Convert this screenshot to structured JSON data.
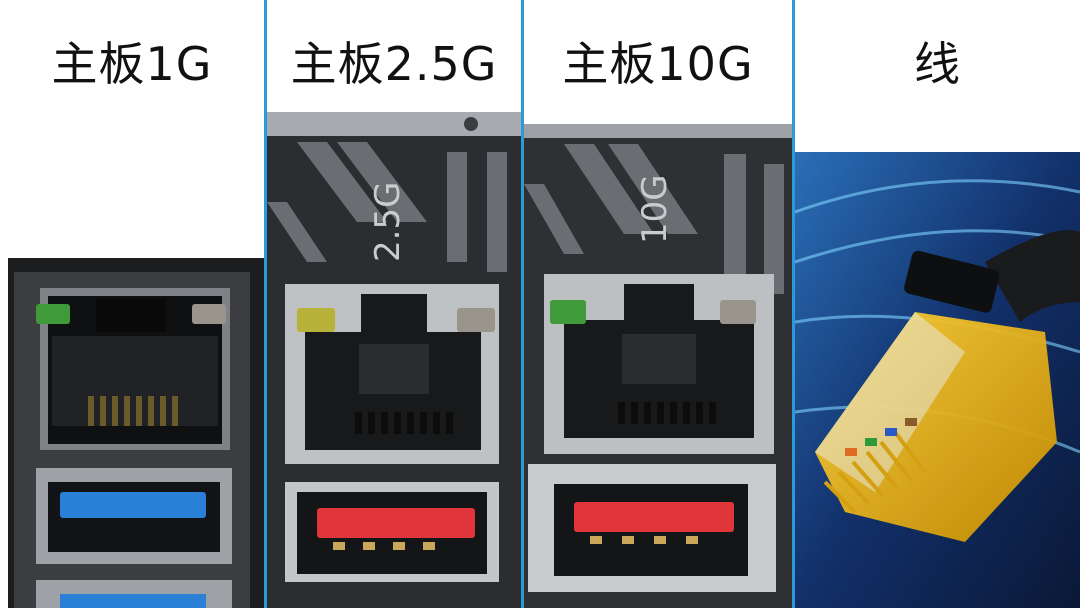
{
  "panels": [
    {
      "label": "主板1G",
      "port_speed_text": ""
    },
    {
      "label": "主板2.5G",
      "port_speed_text": "2.5G"
    },
    {
      "label": "主板10G",
      "port_speed_text": "10G"
    },
    {
      "label": "线",
      "port_speed_text": ""
    }
  ],
  "colors": {
    "divider": "#2c9ad8",
    "usb_blue": "#2a7fd6",
    "usb_red": "#e0353a",
    "led_green": "#3f9a3a",
    "led_yellow": "#b9b23a",
    "connector_gold": "#f0b400",
    "background": "#ffffff"
  },
  "icons": [
    "rj45-port-icon",
    "usb-port-icon",
    "ethernet-cable-icon"
  ]
}
